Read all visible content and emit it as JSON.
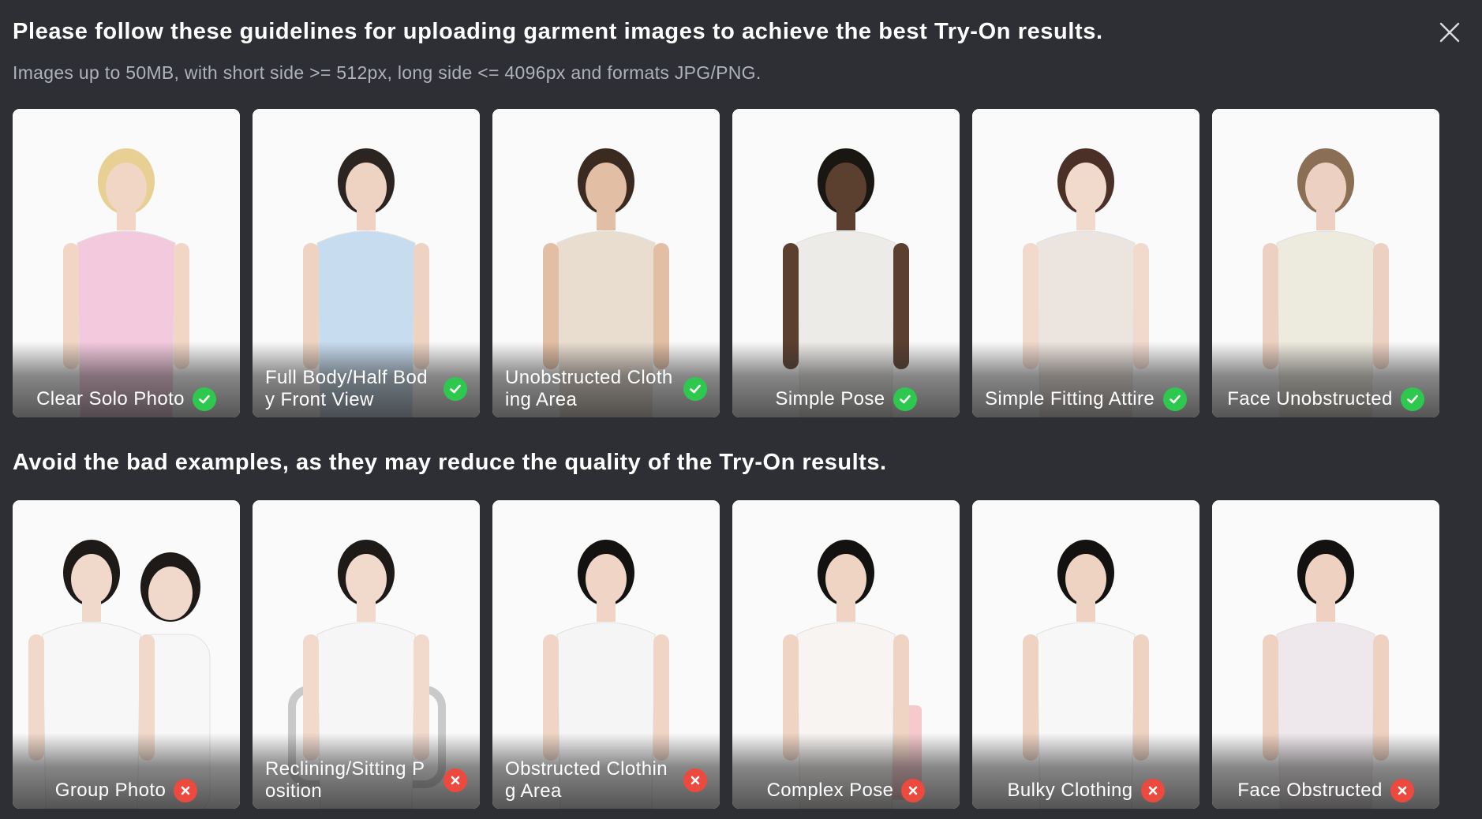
{
  "dialog": {
    "title": "Please follow these guidelines for uploading garment images to achieve the best Try-On results.",
    "subtitle": "Images up to 50MB, with short side >= 512px, long side <= 4096px and formats JPG/PNG.",
    "close_icon": "close-icon"
  },
  "good_examples": {
    "status_icon": "check-circle-icon",
    "status_color": "#2fc84e",
    "items": [
      {
        "label": "Clear Solo Photo",
        "garment_color": "#f3c9dd",
        "hair": "#e8cf93",
        "skin": "#f1d6c6"
      },
      {
        "label": "Full Body/Half Body Front View",
        "garment_color": "#c7dcef",
        "hair": "#2b2420",
        "skin": "#eed3c3"
      },
      {
        "label": "Unobstructed Clothing Area",
        "garment_color": "#e9ddd0",
        "hair": "#3b2a20",
        "skin": "#e1bea4"
      },
      {
        "label": "Simple Pose",
        "garment_color": "#ecebe8",
        "hair": "#1a1612",
        "skin": "#5b3f2f"
      },
      {
        "label": "Simple Fitting Attire",
        "garment_color": "#ece4de",
        "hair": "#4a3026",
        "skin": "#f1d9cc"
      },
      {
        "label": "Face Unobstructed",
        "garment_color": "#edeade",
        "hair": "#8a6f55",
        "skin": "#ecd0c1"
      }
    ]
  },
  "bad_examples": {
    "title": "Avoid the bad examples, as they may reduce the quality of the Try-On results.",
    "status_icon": "x-circle-icon",
    "status_color": "#ec4a3e",
    "items": [
      {
        "label": "Group Photo",
        "garment_color": "#f7f7f7",
        "hair": "#1d1a18",
        "skin": "#f0d8ca"
      },
      {
        "label": "Reclining/Sitting Position",
        "garment_color": "#f6f6f6",
        "hair": "#1d1a18",
        "skin": "#f1d9cc"
      },
      {
        "label": "Obstructed Clothing Area",
        "garment_color": "#f5f5f5",
        "hair": "#141210",
        "skin": "#f0d5c6"
      },
      {
        "label": "Complex Pose",
        "garment_color": "#f7f4f2",
        "hair": "#141210",
        "skin": "#efd3c3"
      },
      {
        "label": "Bulky Clothing",
        "garment_color": "#f7f7f7",
        "hair": "#141210",
        "skin": "#eed2c2"
      },
      {
        "label": "Face Obstructed",
        "garment_color": "#eee8ec",
        "hair": "#141210",
        "skin": "#efd1c1"
      }
    ]
  }
}
